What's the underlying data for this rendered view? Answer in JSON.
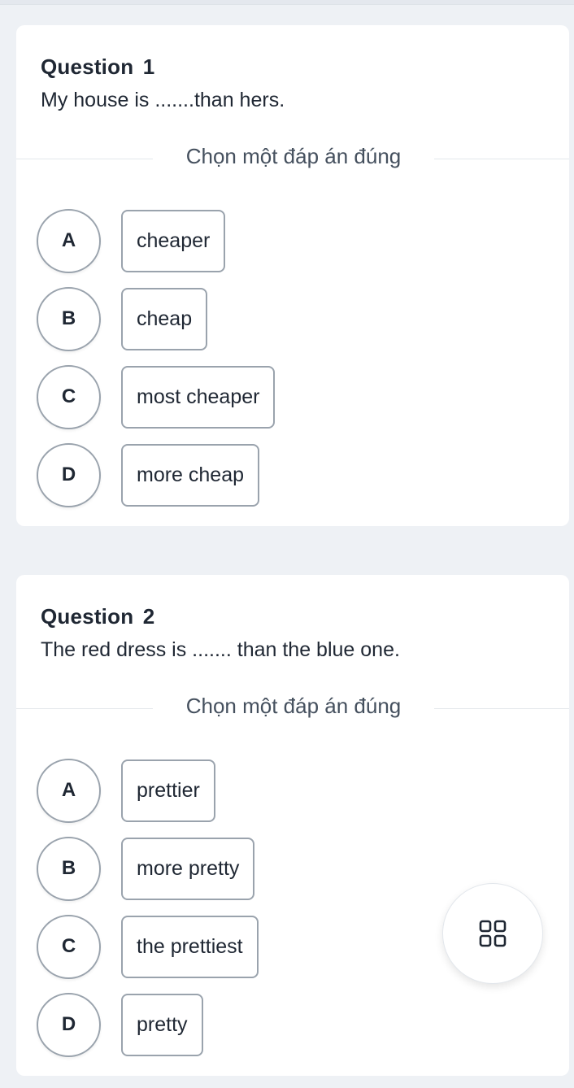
{
  "questions": [
    {
      "title": "Question  1",
      "text": "My house is .......than hers.",
      "instruction": "Chọn một đáp án đúng",
      "options": [
        {
          "letter": "A",
          "label": "cheaper"
        },
        {
          "letter": "B",
          "label": "cheap"
        },
        {
          "letter": "C",
          "label": "most cheaper"
        },
        {
          "letter": "D",
          "label": "more cheap"
        }
      ]
    },
    {
      "title": "Question  2",
      "text": "The red dress is ....... than the blue one.",
      "instruction": "Chọn một đáp án đúng",
      "options": [
        {
          "letter": "A",
          "label": "prettier"
        },
        {
          "letter": "B",
          "label": "more pretty"
        },
        {
          "letter": "C",
          "label": "the prettiest"
        },
        {
          "letter": "D",
          "label": "pretty"
        }
      ]
    }
  ],
  "fab": {
    "icon": "grid-icon"
  }
}
